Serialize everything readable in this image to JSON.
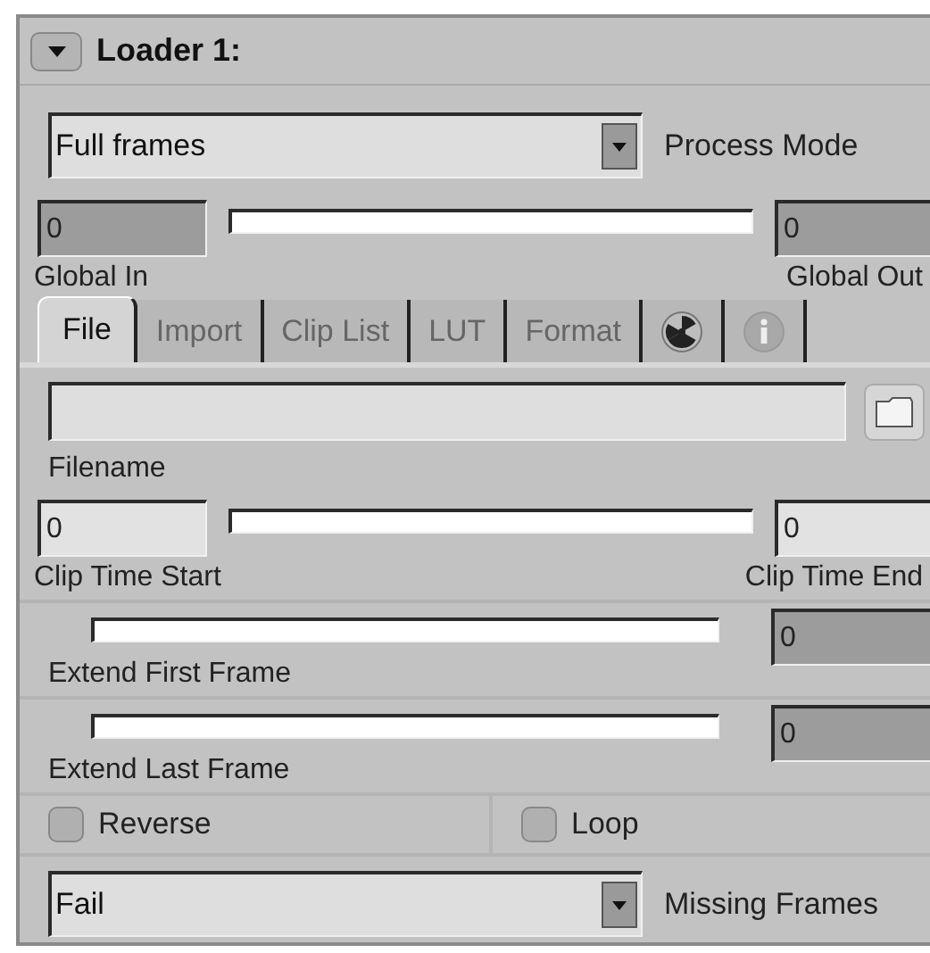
{
  "header": {
    "title": "Loader 1:",
    "expanded": true
  },
  "process_mode": {
    "value": "Full frames",
    "label": "Process Mode"
  },
  "global_range": {
    "start": {
      "value": "0",
      "label": "Global In",
      "disabled": true
    },
    "end": {
      "value": "0",
      "label": "Global Out",
      "disabled": true
    }
  },
  "tabs": [
    {
      "kind": "text",
      "label": "File",
      "selected": true
    },
    {
      "kind": "text",
      "label": "Import",
      "selected": false
    },
    {
      "kind": "text",
      "label": "Clip List",
      "selected": false
    },
    {
      "kind": "text",
      "label": "LUT",
      "selected": false
    },
    {
      "kind": "text",
      "label": "Format",
      "selected": false
    },
    {
      "kind": "radiation",
      "selected": false
    },
    {
      "kind": "info",
      "selected": false
    }
  ],
  "filename": {
    "label": "Filename"
  },
  "clip_range": {
    "start": {
      "value": "0",
      "label": "Clip Time Start",
      "disabled": false
    },
    "end": {
      "value": "0",
      "label": "Clip Time End",
      "disabled": false
    }
  },
  "extend": [
    {
      "label": "Extend First Frame",
      "value": "0",
      "disabled": true
    },
    {
      "label": "Extend Last Frame",
      "value": "0",
      "disabled": true
    }
  ],
  "checkboxes": [
    {
      "label": "Reverse",
      "checked": false
    },
    {
      "label": "Loop",
      "checked": false
    }
  ],
  "missing_frames": {
    "value": "Fail",
    "label": "Missing Frames"
  }
}
